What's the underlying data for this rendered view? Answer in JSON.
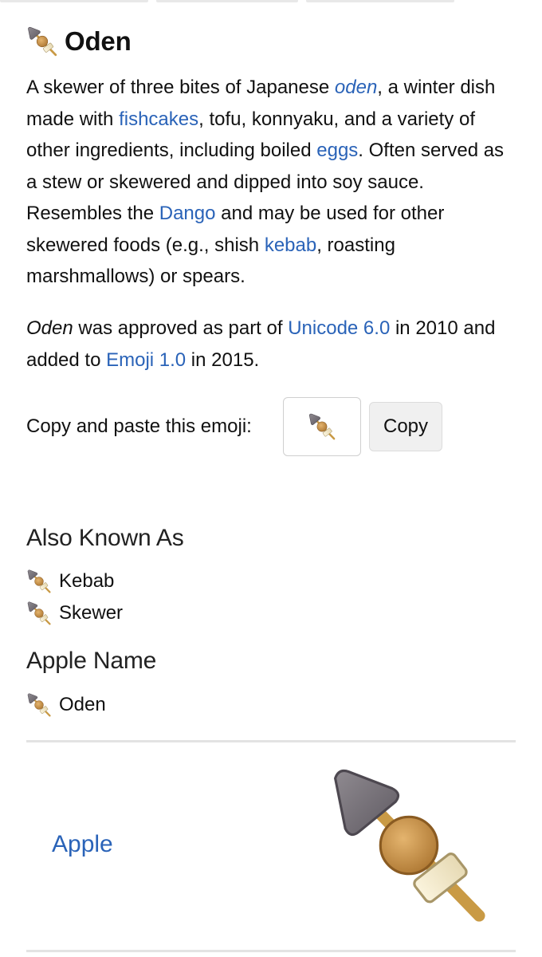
{
  "page": {
    "title": "Oden",
    "title_icon": "oden-emoji-icon"
  },
  "description": {
    "t1": "A skewer of three bites of Japanese ",
    "l1": "oden",
    "t2": ", a winter dish made with ",
    "l2": "fishcakes",
    "t3": ", tofu, konnyaku, and a variety of other ingredients, including boiled ",
    "l3": "eggs",
    "t4": ". Often served as a stew or skewered and dipped into soy sauce. Resembles the ",
    "l4": "Dango",
    "t5": " and may be used for other skewered foods (e.g., shish ",
    "l5": "kebab",
    "t6": ", roasting marshmallows) or spears."
  },
  "approval": {
    "name": "Oden",
    "t1": " was approved as part of ",
    "unicode_link": "Unicode 6.0",
    "t2": " in 2010 and added to ",
    "emoji_link": "Emoji 1.0",
    "t3": " in 2015."
  },
  "copy": {
    "label": "Copy and paste this emoji:",
    "button": "Copy"
  },
  "also_known_as": {
    "heading": "Also Known As",
    "items": [
      "Kebab",
      "Skewer"
    ]
  },
  "apple_name": {
    "heading": "Apple Name",
    "items": [
      "Oden"
    ]
  },
  "vendor": {
    "name": "Apple"
  },
  "colors": {
    "link": "#2a63b8",
    "divider": "#e3e3e3",
    "button_bg": "#f0f0f0"
  }
}
